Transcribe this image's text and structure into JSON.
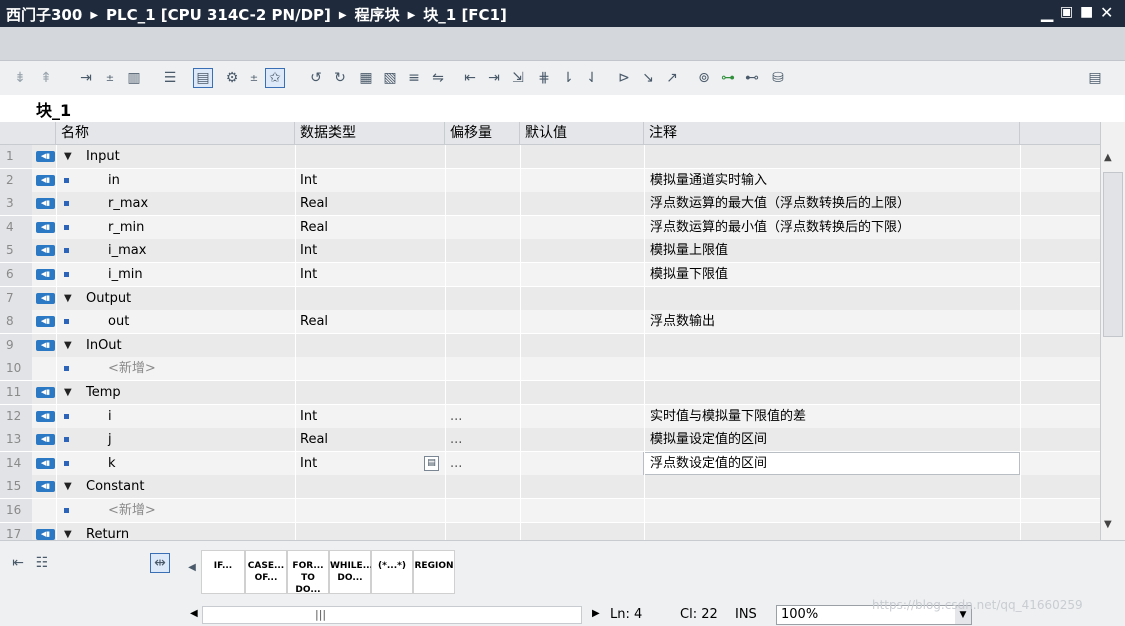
{
  "window": {
    "breadcrumb": [
      "西门子300",
      "PLC_1 [CPU 314C-2 PN/DP]",
      "程序块",
      "块_1 [FC1]"
    ],
    "controls": [
      "minimize-icon",
      "restore-icon",
      "maximize-icon",
      "close-icon"
    ]
  },
  "block": {
    "title": "块_1"
  },
  "table": {
    "headers": {
      "name": "名称",
      "datatype": "数据类型",
      "offset": "偏移量",
      "default": "默认值",
      "comment": "注释"
    },
    "rows": [
      {
        "num": "1",
        "kind": "section",
        "name": "Input",
        "type": "",
        "offset": "",
        "comment": ""
      },
      {
        "num": "2",
        "kind": "var",
        "name": "in",
        "type": "Int",
        "offset": "",
        "comment": "模拟量通道实时输入"
      },
      {
        "num": "3",
        "kind": "var",
        "name": "r_max",
        "type": "Real",
        "offset": "",
        "comment": "浮点数运算的最大值（浮点数转换后的上限）"
      },
      {
        "num": "4",
        "kind": "var",
        "name": "r_min",
        "type": "Real",
        "offset": "",
        "comment": "浮点数运算的最小值（浮点数转换后的下限）"
      },
      {
        "num": "5",
        "kind": "var",
        "name": "i_max",
        "type": "Int",
        "offset": "",
        "comment": "模拟量上限值"
      },
      {
        "num": "6",
        "kind": "var",
        "name": "i_min",
        "type": "Int",
        "offset": "",
        "comment": "模拟量下限值"
      },
      {
        "num": "7",
        "kind": "section",
        "name": "Output",
        "type": "",
        "offset": "",
        "comment": ""
      },
      {
        "num": "8",
        "kind": "var",
        "name": "out",
        "type": "Real",
        "offset": "",
        "comment": "浮点数输出"
      },
      {
        "num": "9",
        "kind": "section",
        "name": "InOut",
        "type": "",
        "offset": "",
        "comment": ""
      },
      {
        "num": "10",
        "kind": "add",
        "name": "<新增>",
        "type": "",
        "offset": "",
        "comment": ""
      },
      {
        "num": "11",
        "kind": "section",
        "name": "Temp",
        "type": "",
        "offset": "",
        "comment": ""
      },
      {
        "num": "12",
        "kind": "var",
        "name": "i",
        "type": "Int",
        "offset": "...",
        "comment": "实时值与模拟量下限值的差"
      },
      {
        "num": "13",
        "kind": "var",
        "name": "j",
        "type": "Real",
        "offset": "...",
        "comment": "模拟量设定值的区间"
      },
      {
        "num": "14",
        "kind": "var",
        "name": "k",
        "type": "Int",
        "offset": "...",
        "comment": "浮点数设定值的区间"
      },
      {
        "num": "15",
        "kind": "section",
        "name": "Constant",
        "type": "",
        "offset": "",
        "comment": ""
      },
      {
        "num": "16",
        "kind": "add",
        "name": "<新增>",
        "type": "",
        "offset": "",
        "comment": ""
      },
      {
        "num": "17",
        "kind": "section",
        "name": "Return",
        "type": "",
        "offset": "",
        "comment": ""
      }
    ]
  },
  "keywords": [
    "IF...",
    "CASE... OF...",
    "FOR... TO DO...",
    "WHILE... DO...",
    "(*...*)",
    "REGION"
  ],
  "status": {
    "ln": "Ln: 4",
    "cl": "Cl: 22",
    "mode": "INS",
    "zoom": "100%",
    "watermark": "https://blog.csdn.net/qq_41660259"
  },
  "colors": {
    "titlebar": "#1f2b3c",
    "interface_icon": "#2b78c4",
    "selected_tool": "#3a6fb5"
  }
}
